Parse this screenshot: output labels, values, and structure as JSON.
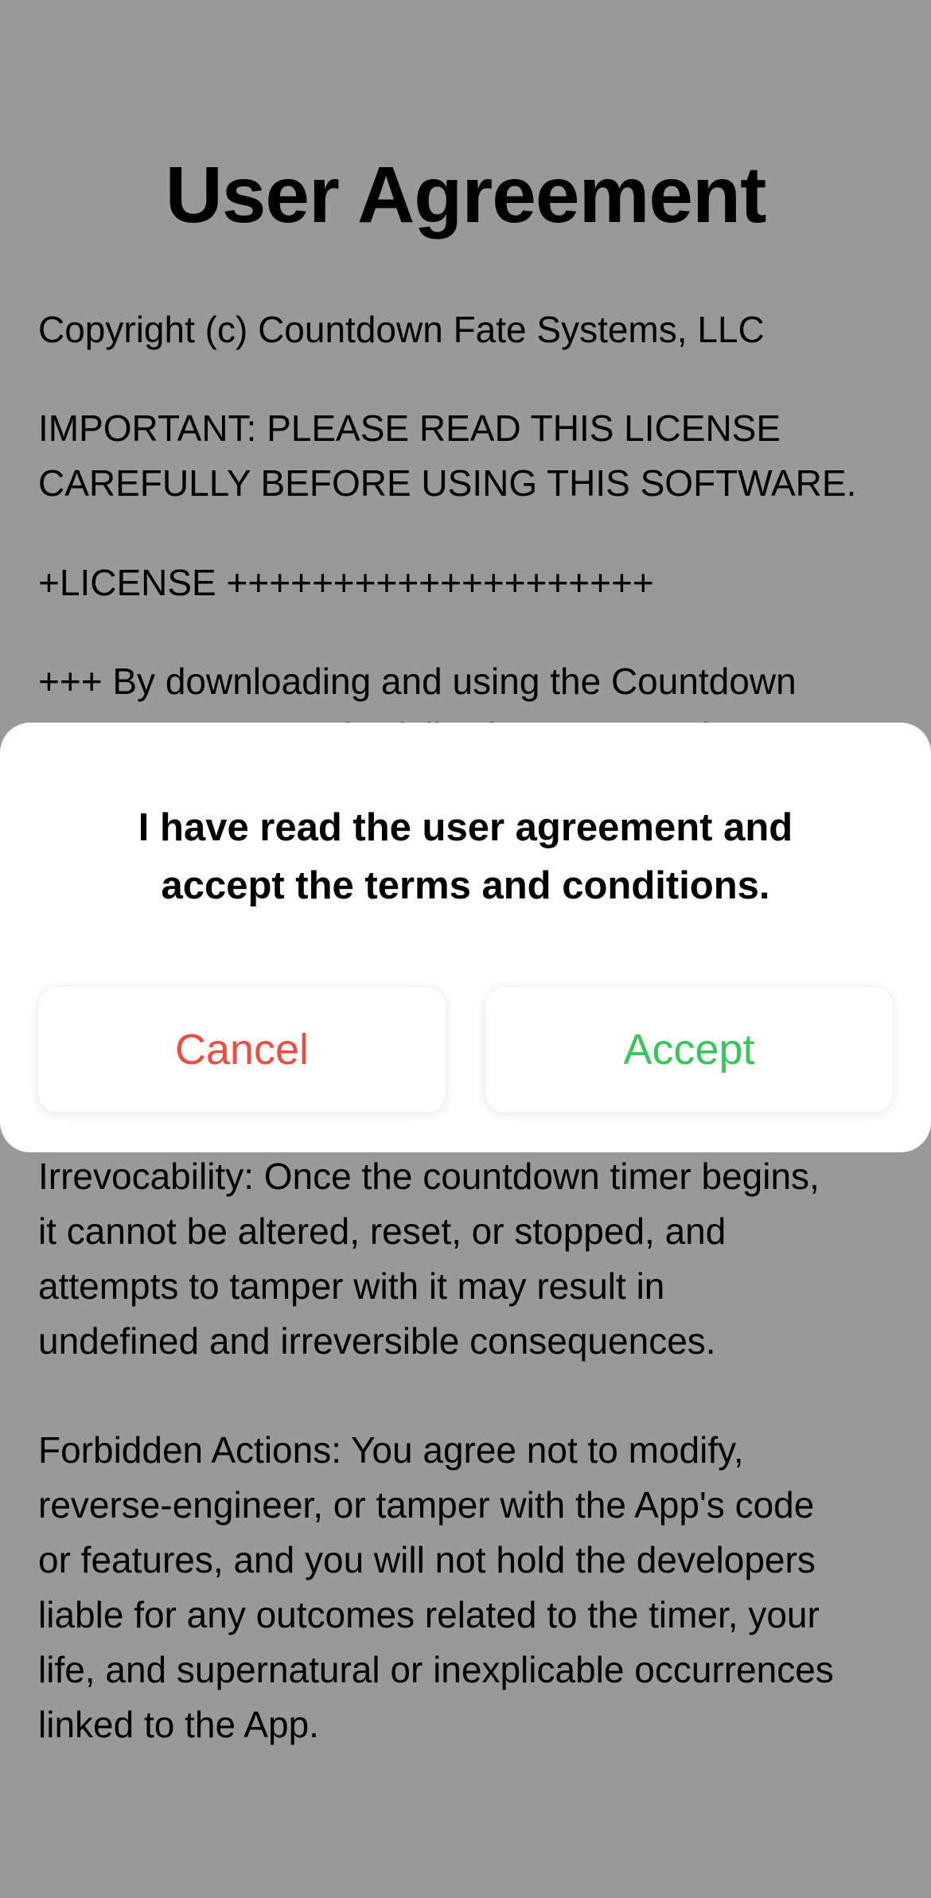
{
  "page": {
    "title": "User Agreement",
    "copyright": "Copyright (c) Countdown Fate Systems, LLC",
    "important": "IMPORTANT: PLEASE READ THIS LICENSE\nCAREFULLY BEFORE USING THIS SOFTWARE.",
    "license_header": "+LICENSE ++++++++++++++++++++",
    "downloading": "+++ By downloading and using the Countdown\napp, you agree to the following terms and",
    "irrevocability": "Irrevocability: Once the countdown timer begins,\nit cannot be altered, reset, or stopped, and\nattempts to tamper with it may result in\nundefined and irreversible consequences.",
    "forbidden": "Forbidden Actions: You agree not to modify,\nreverse-engineer, or tamper with the App's code\nor features, and you will not hold the developers\nliable for any outcomes related to the timer, your\nlife, and supernatural or inexplicable occurrences\nlinked to the App."
  },
  "dialog": {
    "message": "I have read the user agreement and\naccept the terms and conditions.",
    "cancel_label": "Cancel",
    "accept_label": "Accept"
  },
  "colors": {
    "cancel": "#EF4B3F",
    "accept": "#35C759",
    "scrim": "rgba(0,0,0,0.40)"
  }
}
